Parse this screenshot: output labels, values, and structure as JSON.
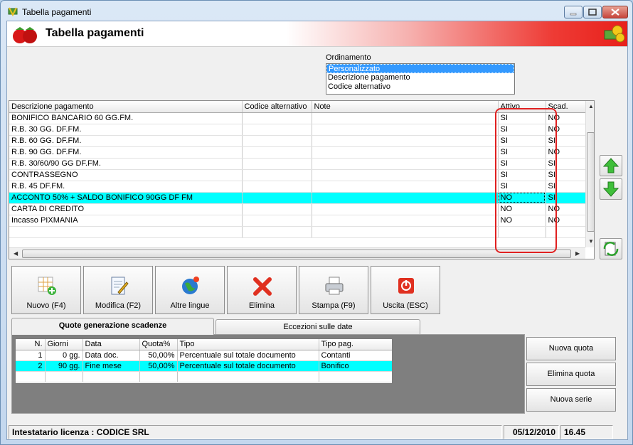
{
  "window": {
    "title": "Tabella pagamenti"
  },
  "header": {
    "title": "Tabella pagamenti"
  },
  "ordinamento": {
    "label": "Ordinamento",
    "options": [
      "Personalizzato",
      "Descrizione pagamento",
      "Codice alternativo"
    ],
    "selected": "Personalizzato"
  },
  "grid": {
    "columns": [
      "Descrizione pagamento",
      "Codice alternativo",
      "Note",
      "Attivo",
      "Scad."
    ],
    "rows": [
      {
        "desc": "BONIFICO BANCARIO 60 GG.FM.",
        "codice": "",
        "note": "",
        "attivo": "SI",
        "scad": "NO"
      },
      {
        "desc": "R.B. 30 GG. DF.FM.",
        "codice": "",
        "note": "",
        "attivo": "SI",
        "scad": "NO"
      },
      {
        "desc": "R.B. 60 GG. DF.FM.",
        "codice": "",
        "note": "",
        "attivo": "SI",
        "scad": "SI"
      },
      {
        "desc": "R.B. 90 GG. DF.FM.",
        "codice": "",
        "note": "",
        "attivo": "SI",
        "scad": "NO"
      },
      {
        "desc": "R.B. 30/60/90 GG DF.FM.",
        "codice": "",
        "note": "",
        "attivo": "SI",
        "scad": "SI"
      },
      {
        "desc": "CONTRASSEGNO",
        "codice": "",
        "note": "",
        "attivo": "SI",
        "scad": "SI"
      },
      {
        "desc": "R.B. 45 DF.FM.",
        "codice": "",
        "note": "",
        "attivo": "SI",
        "scad": "SI"
      },
      {
        "desc": "ACCONTO 50% + SALDO BONIFICO 90GG DF FM",
        "codice": "",
        "note": "",
        "attivo": "NO",
        "scad": "SI"
      },
      {
        "desc": "CARTA DI CREDITO",
        "codice": "",
        "note": "",
        "attivo": "NO",
        "scad": "NO"
      },
      {
        "desc": "Incasso PIXMANIA",
        "codice": "",
        "note": "",
        "attivo": "NO",
        "scad": "NO"
      }
    ],
    "selected_row": 7
  },
  "toolbar": {
    "nuovo": "Nuovo (F4)",
    "modifica": "Modifica (F2)",
    "lingue": "Altre lingue",
    "elimina": "Elimina",
    "stampa": "Stampa (F9)",
    "uscita": "Uscita (ESC)"
  },
  "tabs": [
    "Quote generazione scadenze",
    "Eccezioni sulle date"
  ],
  "quote": {
    "columns": [
      "N.",
      "Giorni",
      "Data",
      "Quota%",
      "Tipo",
      "Tipo pag."
    ],
    "rows": [
      {
        "n": "1",
        "giorni": "0 gg.",
        "data": "Data doc.",
        "quota": "50,00%",
        "tipo": "Percentuale sul totale documento",
        "tipopag": "Contanti"
      },
      {
        "n": "2",
        "giorni": "90 gg.",
        "data": "Fine mese",
        "quota": "50,00%",
        "tipo": "Percentuale sul totale documento",
        "tipopag": "Bonifico"
      }
    ]
  },
  "side_buttons": {
    "nuova_quota": "Nuova quota",
    "elimina_quota": "Elimina quota",
    "nuova_serie": "Nuova serie"
  },
  "status": {
    "licenza": "Intestatario licenza : CODICE SRL",
    "date": "05/12/2010",
    "time": "16.45"
  },
  "colors": {
    "highlight": "#00ffff",
    "selection": "#3399ff",
    "header_red": "#e8201b"
  }
}
